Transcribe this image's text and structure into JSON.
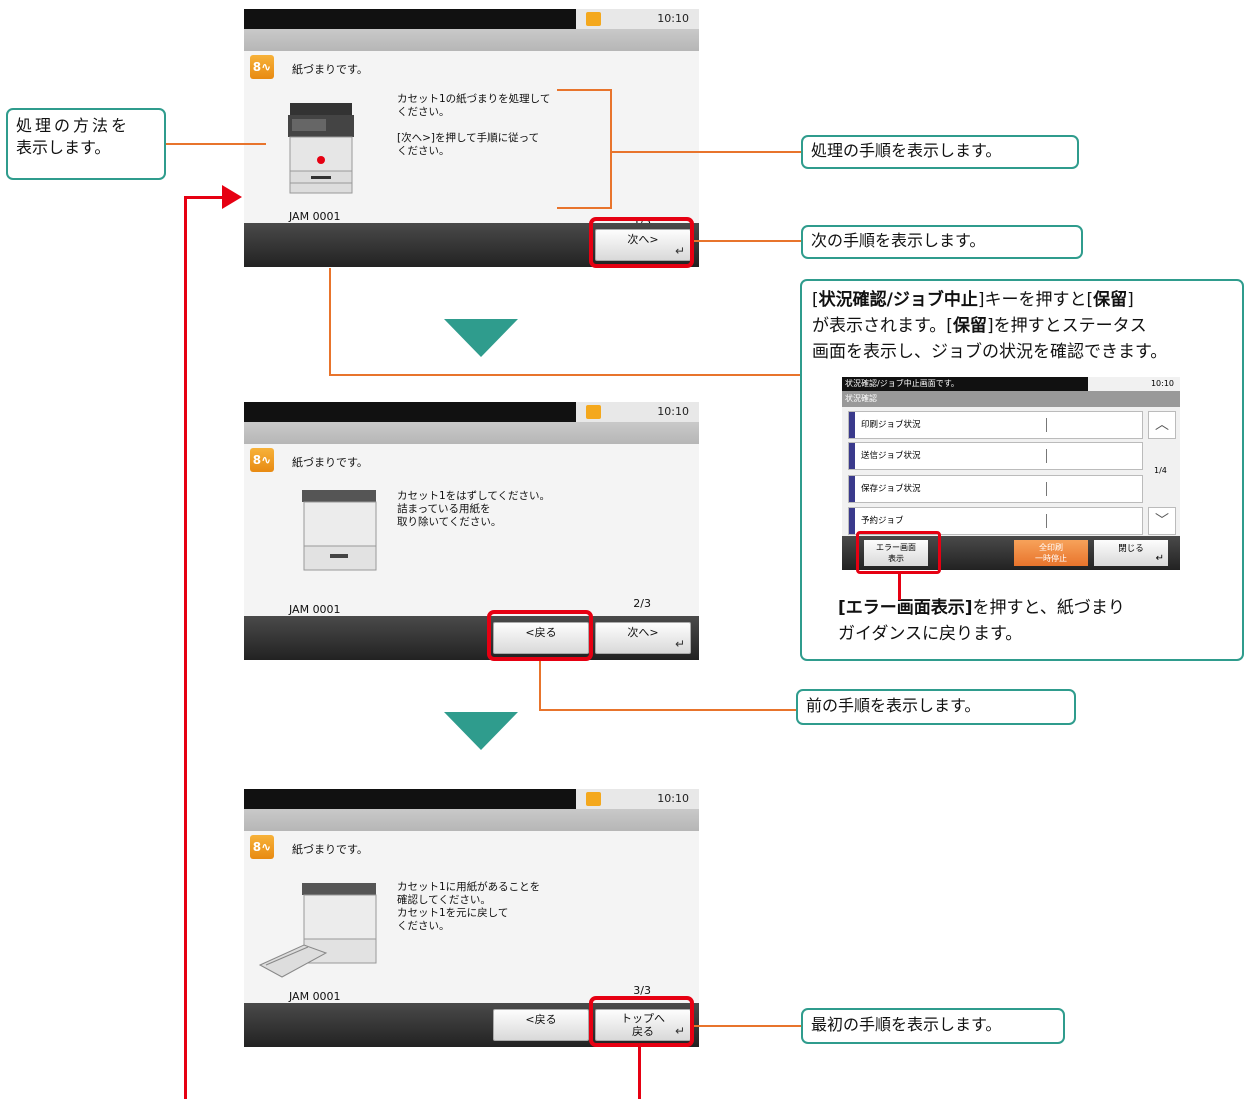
{
  "screen1": {
    "time": "10:10",
    "title": "紙づまりです。",
    "message": "カセット1の紙づまりを処理して\nください。\n\n[次へ>]を押して手順に従って\nください。",
    "jam_code": "JAM 0001",
    "page": "1/3",
    "next_label": "次へ>"
  },
  "screen2": {
    "time": "10:10",
    "title": "紙づまりです。",
    "message": "カセット1をはずしてください。\n詰まっている用紙を\n取り除いてください。",
    "jam_code": "JAM 0001",
    "page": "2/3",
    "back_label": "<戻る",
    "next_label": "次へ>"
  },
  "screen3": {
    "time": "10:10",
    "title": "紙づまりです。",
    "message": "カセット1に用紙があることを\n確認してください。\nカセット1を元に戻して\nください。",
    "jam_code": "JAM 0001",
    "page": "3/3",
    "back_label": "<戻る",
    "top_label_1": "トップへ",
    "top_label_2": "戻る"
  },
  "callouts": {
    "method_1": "処理の方法を",
    "method_2": "表示します。",
    "steps": "処理の手順を表示します。",
    "next_step": "次の手順を表示します。",
    "status_1a": "[",
    "status_1b": "状況確認/ジョブ中止",
    "status_1c": "]キーを押すと[",
    "status_1d": "保留",
    "status_1e": "]",
    "status_2a": "が表示されます。[",
    "status_2b": "保留",
    "status_2c": "]を押すとステータス",
    "status_3": "画面を表示し、ジョブの状況を確認できます。",
    "error_1a": "[エラー画面表示]",
    "error_1b": "を押すと、紙づまり",
    "error_2": "ガイダンスに戻ります。",
    "prev_step": "前の手順を表示します。",
    "first_step": "最初の手順を表示します。"
  },
  "mini_screen": {
    "header": "状況確認/ジョブ中止画面です。",
    "time": "10:10",
    "subheader": "状況確認",
    "rows": [
      "印刷ジョブ状況",
      "送信ジョブ状況",
      "保存ジョブ状況",
      "予約ジョブ"
    ],
    "page": "1/4",
    "error_btn_1": "エラー画面",
    "error_btn_2": "表示",
    "stop_btn_1": "全印刷",
    "stop_btn_2": "一時停止",
    "close_btn": "閉じる"
  },
  "colors": {
    "accent_teal": "#2f9c8d",
    "line_orange": "#e8742c",
    "highlight_red": "#e60012",
    "jam_icon_orange": "#f4a81d"
  }
}
